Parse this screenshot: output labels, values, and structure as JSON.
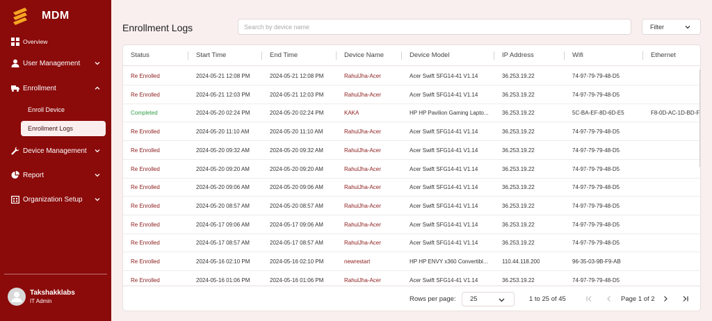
{
  "brand": {
    "name": "MDM",
    "accent": "#f5a623",
    "sidebar_color": "#8b0a0a"
  },
  "sidebar": {
    "items": [
      {
        "label": "Overview",
        "icon": "grid-icon"
      },
      {
        "label": "User Management",
        "icon": "user-icon",
        "chevron": "down"
      },
      {
        "label": "Enrollment",
        "icon": "truck-icon",
        "chevron": "up",
        "children": [
          {
            "label": "Enroll Device"
          },
          {
            "label": "Enrollment Logs",
            "active": true
          }
        ]
      },
      {
        "label": "Device Management",
        "icon": "wrench-icon",
        "chevron": "down"
      },
      {
        "label": "Report",
        "icon": "pie-chart-icon",
        "chevron": "down"
      },
      {
        "label": "Organization Setup",
        "icon": "building-icon",
        "chevron": "down"
      }
    ]
  },
  "user": {
    "name": "Takshakklabs",
    "role": "IT Admin"
  },
  "header": {
    "title": "Enrollment Logs",
    "search_placeholder": "Search by device name",
    "filter_label": "Filter"
  },
  "table": {
    "columns": [
      "Status",
      "Start Time",
      "End Time",
      "Device Name",
      "Device Model",
      "IP Address",
      "Wifi",
      "Ethernet"
    ],
    "rows": [
      {
        "status": "Re Enrolled",
        "start": "2024-05-21 12:08 PM",
        "end": "2024-05-21 12:08 PM",
        "device": "RahulJha-Acer",
        "model": "Acer Swift SFG14-41 V1.14",
        "ip": "36.253.19.22",
        "wifi": "74-97-79-79-48-D5",
        "ethernet": ""
      },
      {
        "status": "Re Enrolled",
        "start": "2024-05-21 12:03 PM",
        "end": "2024-05-21 12:03 PM",
        "device": "RahulJha-Acer",
        "model": "Acer Swift SFG14-41 V1.14",
        "ip": "36.253.19.22",
        "wifi": "74-97-79-79-48-D5",
        "ethernet": ""
      },
      {
        "status": "Completed",
        "start": "2024-05-20 02:24 PM",
        "end": "2024-05-20 02:24 PM",
        "device": "KAKA",
        "model": "HP HP Pavilion Gaming Lapto...",
        "ip": "36.253.19.22",
        "wifi": "5C-BA-EF-8D-6D-E5",
        "ethernet": "F8-0D-AC-1D-BD-F"
      },
      {
        "status": "Re Enrolled",
        "start": "2024-05-20 11:10 AM",
        "end": "2024-05-20 11:10 AM",
        "device": "RahulJha-Acer",
        "model": "Acer Swift SFG14-41 V1.14",
        "ip": "36.253.19.22",
        "wifi": "74-97-79-79-48-D5",
        "ethernet": ""
      },
      {
        "status": "Re Enrolled",
        "start": "2024-05-20 09:32 AM",
        "end": "2024-05-20 09:32 AM",
        "device": "RahulJha-Acer",
        "model": "Acer Swift SFG14-41 V1.14",
        "ip": "36.253.19.22",
        "wifi": "74-97-79-79-48-D5",
        "ethernet": ""
      },
      {
        "status": "Re Enrolled",
        "start": "2024-05-20 09:20 AM",
        "end": "2024-05-20 09:20 AM",
        "device": "RahulJha-Acer",
        "model": "Acer Swift SFG14-41 V1.14",
        "ip": "36.253.19.22",
        "wifi": "74-97-79-79-48-D5",
        "ethernet": ""
      },
      {
        "status": "Re Enrolled",
        "start": "2024-05-20 09:06 AM",
        "end": "2024-05-20 09:06 AM",
        "device": "RahulJha-Acer",
        "model": "Acer Swift SFG14-41 V1.14",
        "ip": "36.253.19.22",
        "wifi": "74-97-79-79-48-D5",
        "ethernet": ""
      },
      {
        "status": "Re Enrolled",
        "start": "2024-05-20 08:57 AM",
        "end": "2024-05-20 08:57 AM",
        "device": "RahulJha-Acer",
        "model": "Acer Swift SFG14-41 V1.14",
        "ip": "36.253.19.22",
        "wifi": "74-97-79-79-48-D5",
        "ethernet": ""
      },
      {
        "status": "Re Enrolled",
        "start": "2024-05-17 09:06 AM",
        "end": "2024-05-17 09:06 AM",
        "device": "RahulJha-Acer",
        "model": "Acer Swift SFG14-41 V1.14",
        "ip": "36.253.19.22",
        "wifi": "74-97-79-79-48-D5",
        "ethernet": ""
      },
      {
        "status": "Re Enrolled",
        "start": "2024-05-17 08:57 AM",
        "end": "2024-05-17 08:57 AM",
        "device": "RahulJha-Acer",
        "model": "Acer Swift SFG14-41 V1.14",
        "ip": "36.253.19.22",
        "wifi": "74-97-79-79-48-D5",
        "ethernet": ""
      },
      {
        "status": "Re Enrolled",
        "start": "2024-05-16 02:10 PM",
        "end": "2024-05-16 02:10 PM",
        "device": "newrestart",
        "model": "HP HP ENVY x360 Convertibl...",
        "ip": "110.44.118.200",
        "wifi": "96-35-03-9B-F9-AB",
        "ethernet": ""
      },
      {
        "status": "Re Enrolled",
        "start": "2024-05-16 01:06 PM",
        "end": "2024-05-16 01:06 PM",
        "device": "RahulJha-Acer",
        "model": "Acer Swift SFG14-41 V1.14",
        "ip": "36.253.19.22",
        "wifi": "74-97-79-79-48-D5",
        "ethernet": ""
      }
    ]
  },
  "pagination": {
    "rows_per_page_label": "Rows per page:",
    "rows_per_page": "25",
    "range": "1 to 25 of 45",
    "page": "Page 1 of 2"
  }
}
